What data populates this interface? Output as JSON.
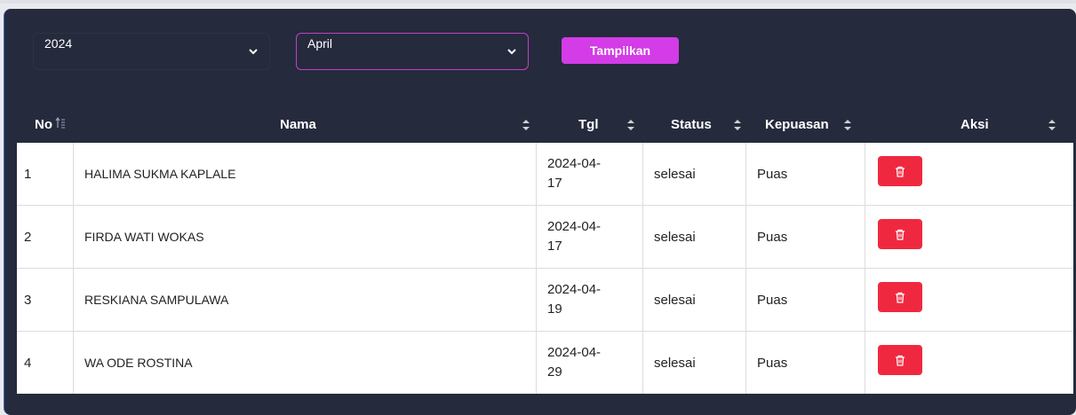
{
  "filters": {
    "year_value": "2024",
    "month_value": "April",
    "show_button": "Tampilkan"
  },
  "table": {
    "headers": {
      "no": "No",
      "nama": "Nama",
      "tgl": "Tgl",
      "status": "Status",
      "kepuasan": "Kepuasan",
      "aksi": "Aksi"
    },
    "rows": [
      {
        "no": "1",
        "nama": "HALIMA SUKMA KAPLALE",
        "tgl_a": "2024-04-",
        "tgl_b": "17",
        "status": "selesai",
        "kepuasan": "Puas"
      },
      {
        "no": "2",
        "nama": "FIRDA WATI WOKAS",
        "tgl_a": "2024-04-",
        "tgl_b": "17",
        "status": "selesai",
        "kepuasan": "Puas"
      },
      {
        "no": "3",
        "nama": "RESKIANA SAMPULAWA",
        "tgl_a": "2024-04-",
        "tgl_b": "19",
        "status": "selesai",
        "kepuasan": "Puas"
      },
      {
        "no": "4",
        "nama": "WA ODE ROSTINA",
        "tgl_a": "2024-04-",
        "tgl_b": "29",
        "status": "selesai",
        "kepuasan": "Puas"
      }
    ]
  },
  "icons": {
    "chevron": "chevron-down-icon",
    "sort": "sort-icon",
    "delete": "trash-icon"
  },
  "colors": {
    "panel_bg": "#262a3d",
    "accent": "#d33ce6",
    "delete": "#f0283f"
  }
}
